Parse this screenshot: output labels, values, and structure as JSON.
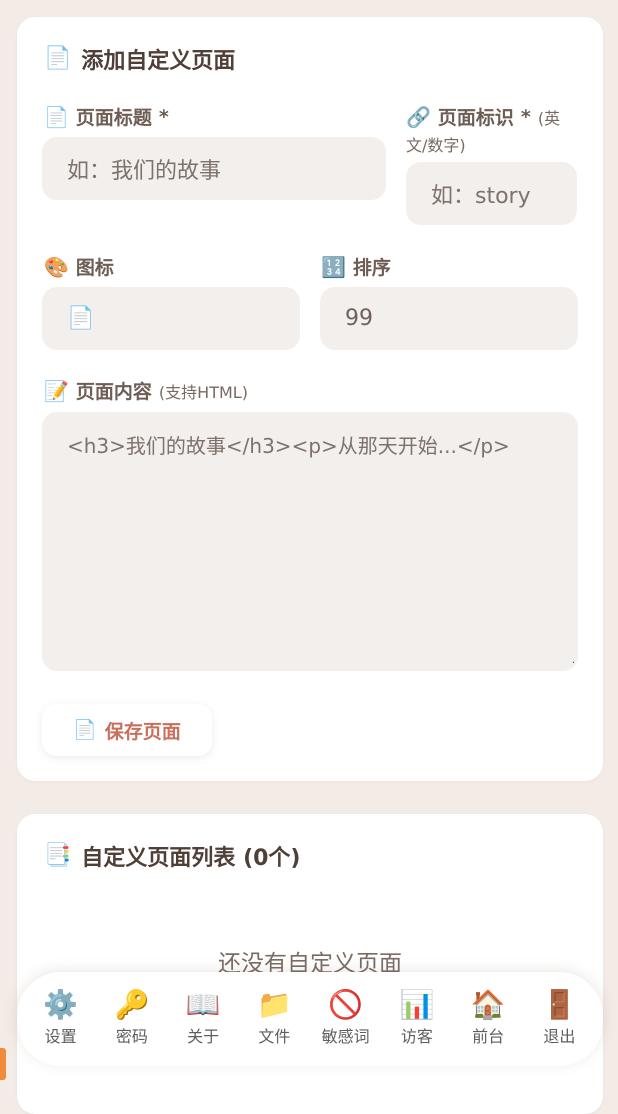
{
  "add_card": {
    "icon": "📄",
    "title": "添加自定义页面",
    "fields": {
      "title": {
        "icon": "📄",
        "label": "页面标题",
        "required": "*",
        "placeholder": "如：我们的故事"
      },
      "slug": {
        "icon": "🔗",
        "label": "页面标识",
        "required": "*",
        "hint_line1": "(英",
        "hint_line2": "文/数字)",
        "placeholder": "如：story"
      },
      "icon": {
        "icon": "🎨",
        "label": "图标",
        "value": "📄"
      },
      "order": {
        "icon": "🔢",
        "label": "排序",
        "value": "99"
      },
      "content": {
        "icon": "📝",
        "label": "页面内容",
        "hint": "(支持HTML)",
        "placeholder": "<h3>我们的故事</h3><p>从那天开始...</p>"
      }
    },
    "save_button": {
      "icon": "📄",
      "label": "保存页面"
    }
  },
  "list_card": {
    "icon": "📑",
    "title": "自定义页面列表 (0个)",
    "empty_text": "还没有自定义页面"
  },
  "bottom_nav": [
    {
      "icon": "⚙️",
      "label": "设置"
    },
    {
      "icon": "🔑",
      "label": "密码"
    },
    {
      "icon": "📖",
      "label": "关于"
    },
    {
      "icon": "📁",
      "label": "文件"
    },
    {
      "icon": "🚫",
      "label": "敏感词"
    },
    {
      "icon": "📊",
      "label": "访客"
    },
    {
      "icon": "🏠",
      "label": "前台"
    },
    {
      "icon": "🚪",
      "label": "退出"
    }
  ],
  "colors": {
    "accent": "#c96f5d",
    "background": "#f3ebe6",
    "input_bg": "#f3efec",
    "side_mark": "#f08a3c"
  }
}
